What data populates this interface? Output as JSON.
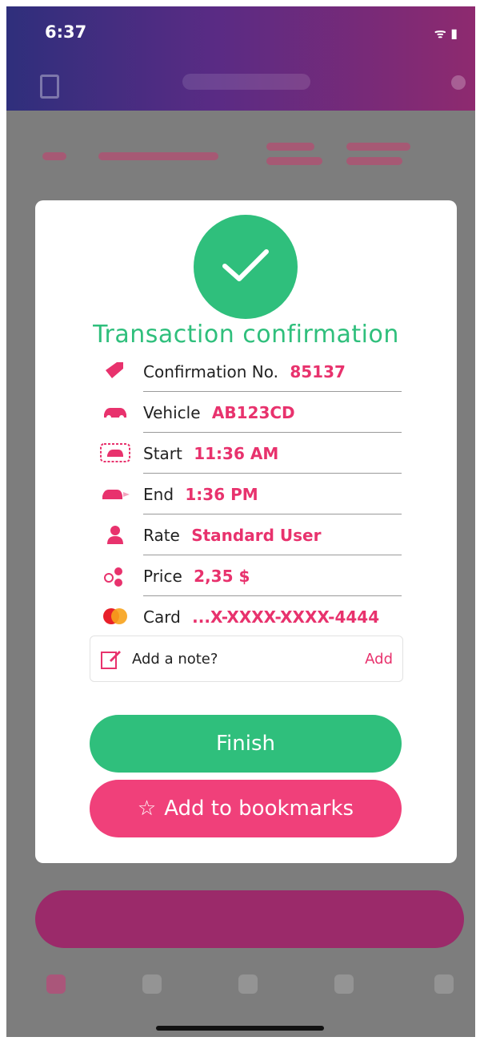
{
  "status_bar": {
    "time": "6:37",
    "icons": "ᯤ ▮"
  },
  "modal": {
    "title": "Transaction confirmation",
    "rows": [
      {
        "icon": "tag-icon",
        "label": "Confirmation No.",
        "value": "85137"
      },
      {
        "icon": "car-icon",
        "label": "Vehicle",
        "value": "AB123CD"
      },
      {
        "icon": "parking-start-icon",
        "label": "Start",
        "value": "11:36 AM"
      },
      {
        "icon": "parking-end-icon",
        "label": "End",
        "value": "1:36 PM"
      },
      {
        "icon": "user-icon",
        "label": "Rate",
        "value": "Standard User"
      },
      {
        "icon": "coins-icon",
        "label": "Price",
        "value": "2,35 $"
      },
      {
        "icon": "mastercard-icon",
        "label": "Card",
        "value": "...X-XXXX-XXXX-4444"
      }
    ],
    "note": {
      "label": "Add a note?",
      "action": "Add"
    },
    "buttons": {
      "finish": "Finish",
      "bookmark": "Add to bookmarks"
    }
  },
  "colors": {
    "accent_green": "#2fbf7c",
    "accent_pink": "#e8326d"
  }
}
